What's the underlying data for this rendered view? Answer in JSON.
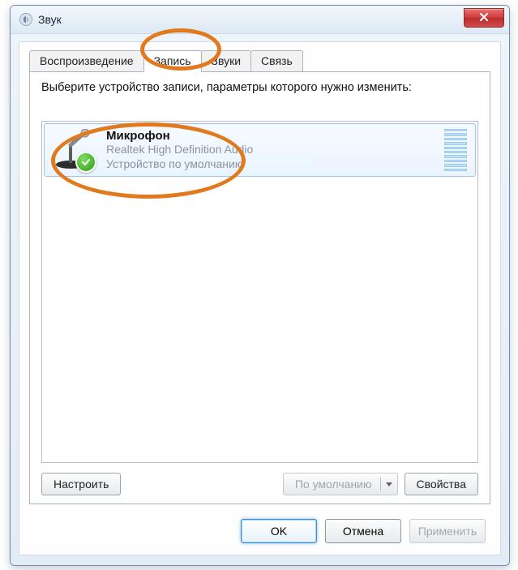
{
  "window": {
    "title": "Звук"
  },
  "tabs": [
    {
      "label": "Воспроизведение",
      "active": false
    },
    {
      "label": "Запись",
      "active": true
    },
    {
      "label": "Звуки",
      "active": false
    },
    {
      "label": "Связь",
      "active": false
    }
  ],
  "instruction": "Выберите устройство записи, параметры которого нужно изменить:",
  "devices": [
    {
      "name": "Микрофон",
      "driver": "Realtek High Definition Audio",
      "status": "Устройство по умолчанию",
      "default": true,
      "selected": true,
      "level_bars": 10
    }
  ],
  "panel_buttons": {
    "configure": "Настроить",
    "set_default": "По умолчанию",
    "properties": "Свойства"
  },
  "dialog_buttons": {
    "ok": "OK",
    "cancel": "Отмена",
    "apply": "Применить"
  }
}
